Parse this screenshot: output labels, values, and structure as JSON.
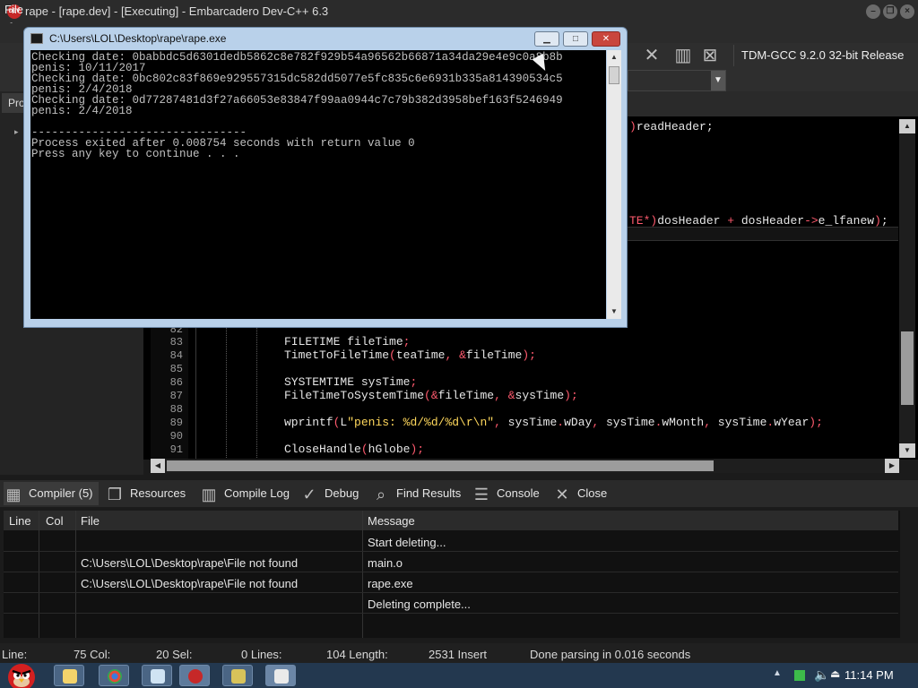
{
  "window": {
    "title": "rape - [rape.dev] - [Executing] - Embarcadero Dev-C++ 6.3",
    "app_icon_text": "DEV C++",
    "minimize": "–",
    "restore": "❐",
    "close": "×"
  },
  "menu": {
    "file": "File"
  },
  "toolbar": {
    "compiler": "TDM-GCC 9.2.0 32-bit Release",
    "combo_arrow": "▼"
  },
  "left_panel": {
    "tab": "Pro",
    "toggle": "▸"
  },
  "editor": {
    "fragments": {
      "read_header": ")readHeader;",
      "dos_header": "TE*)dosHeader + dosHeader->e_lfanew);"
    },
    "lines": [
      {
        "num": "82",
        "code": ""
      },
      {
        "num": "83",
        "code": "FILETIME fileTime;"
      },
      {
        "num": "84",
        "code": "TimetToFileTime(teaTime, &fileTime);"
      },
      {
        "num": "85",
        "code": ""
      },
      {
        "num": "86",
        "code": "SYSTEMTIME sysTime;"
      },
      {
        "num": "87",
        "code": "FileTimeToSystemTime(&fileTime, &sysTime);"
      },
      {
        "num": "88",
        "code": ""
      },
      {
        "num": "89",
        "code": "wprintf(L\"penis: %d/%d/%d\\r\\n\", sysTime.wDay, sysTime.wMonth, sysTime.wYear);"
      },
      {
        "num": "90",
        "code": ""
      },
      {
        "num": "91",
        "code": "CloseHandle(hGlobe);"
      }
    ]
  },
  "bottom_tabs": [
    {
      "label": "Compiler (5)",
      "icon": "grid-icon"
    },
    {
      "label": "Resources",
      "icon": "resources-icon"
    },
    {
      "label": "Compile Log",
      "icon": "bar-chart-icon"
    },
    {
      "label": "Debug",
      "icon": "check-icon"
    },
    {
      "label": "Find Results",
      "icon": "find-icon"
    },
    {
      "label": "Console",
      "icon": "console-icon"
    },
    {
      "label": "Close",
      "icon": "close-icon"
    }
  ],
  "messages": {
    "columns": [
      "Line",
      "Col",
      "File",
      "Message"
    ],
    "rows": [
      {
        "line": "",
        "col": "",
        "file": "",
        "message": "Start deleting..."
      },
      {
        "line": "",
        "col": "",
        "file": "C:\\Users\\LOL\\Desktop\\rape\\File not found",
        "message": "main.o"
      },
      {
        "line": "",
        "col": "",
        "file": "C:\\Users\\LOL\\Desktop\\rape\\File not found",
        "message": "rape.exe"
      },
      {
        "line": "",
        "col": "",
        "file": "",
        "message": "Deleting complete..."
      }
    ]
  },
  "status": {
    "line_label": "Line:",
    "line_value": "75 Col:",
    "col_value": "20 Sel:",
    "sel_value": "0 Lines:",
    "lines_value": "104 Length:",
    "length_value": "2531 Insert",
    "parse": "Done parsing in 0.016 seconds"
  },
  "console": {
    "title": "C:\\Users\\LOL\\Desktop\\rape\\rape.exe",
    "lines": [
      "Checking date: 0babbdc5d6301dedb5862c8e782f929b54a96562b66871a34da29e4e9c0a8b8b",
      "penis: 10/11/2017",
      "Checking date: 0bc802c83f869e929557315dc582dd5077e5fc835c6e6931b335a814390534c5",
      "penis: 2/4/2018",
      "Checking date: 0d77287481d3f27a66053e83847f99aa0944c7c79b382d3958bef163f5246949",
      "penis: 2/4/2018",
      "",
      "--------------------------------",
      "Process exited after 0.008754 seconds with return value 0",
      "Press any key to continue . . ."
    ]
  },
  "taskbar": {
    "clock": "11:14 PM"
  }
}
